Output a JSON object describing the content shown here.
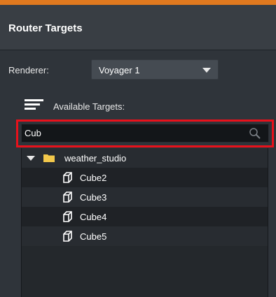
{
  "header": {
    "title": "Router Targets"
  },
  "renderer": {
    "label": "Renderer:",
    "selected": "Voyager 1"
  },
  "targets": {
    "label": "Available Targets:"
  },
  "search": {
    "value": "Cub"
  },
  "tree": {
    "folder": {
      "label": "weather_studio",
      "expanded": true
    },
    "items": [
      {
        "label": "Cube2"
      },
      {
        "label": "Cube3"
      },
      {
        "label": "Cube4"
      },
      {
        "label": "Cube5"
      }
    ]
  },
  "colors": {
    "accent": "#e0791f",
    "highlight": "#e8111b",
    "folder": "#f2c84b",
    "panel": "#2f343a"
  }
}
